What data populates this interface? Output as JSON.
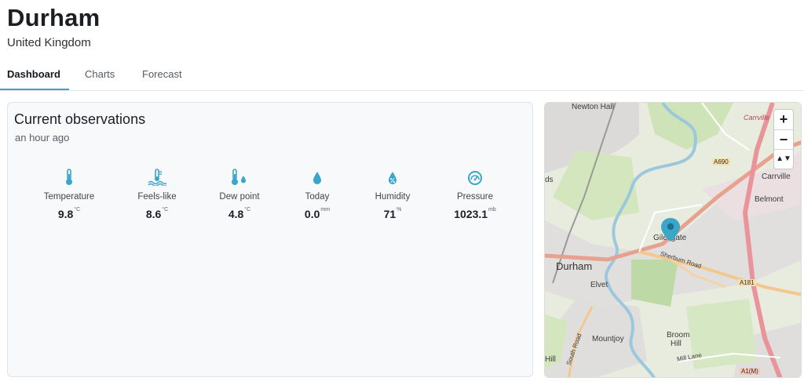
{
  "header": {
    "city": "Durham",
    "country": "United Kingdom"
  },
  "tabs": [
    {
      "label": "Dashboard",
      "active": true
    },
    {
      "label": "Charts",
      "active": false
    },
    {
      "label": "Forecast",
      "active": false
    }
  ],
  "observations": {
    "title": "Current observations",
    "updated": "an hour ago",
    "metrics": [
      {
        "label": "Temperature",
        "value": "9.8",
        "unit": "°C",
        "icon": "thermometer-icon"
      },
      {
        "label": "Feels-like",
        "value": "8.6",
        "unit": "°C",
        "icon": "feels-like-icon"
      },
      {
        "label": "Dew point",
        "value": "4.8",
        "unit": "°C",
        "icon": "dew-point-icon"
      },
      {
        "label": "Today",
        "value": "0.0",
        "unit": "mm",
        "icon": "raindrop-icon"
      },
      {
        "label": "Humidity",
        "value": "71",
        "unit": "%",
        "icon": "humidity-icon"
      },
      {
        "label": "Pressure",
        "value": "1023.1",
        "unit": "mb",
        "icon": "gauge-icon"
      }
    ],
    "accent": "#3aa6c9"
  },
  "map": {
    "zoom_in": "+",
    "zoom_out": "−",
    "compass": "▲▼",
    "labels": {
      "newton_hall": "Newton Hall",
      "carrville_top": "Carrville",
      "carrville": "Carrville",
      "a690": "A690",
      "ds": "ds",
      "belmont": "Belmont",
      "gilesgate": "Gilesgate",
      "sherburn_road": "Sherburn Road",
      "durham": "Durham",
      "elvet": "Elvet",
      "a181": "A181",
      "broom_hill_1": "Broom",
      "broom_hill_2": "Hill",
      "mountjoy": "Mountjoy",
      "south_road": "South Road",
      "hill": "Hill",
      "mill_lane": "Mill Lane",
      "a1m": "A1(M)"
    },
    "marker_color": "#3aa6c9"
  }
}
